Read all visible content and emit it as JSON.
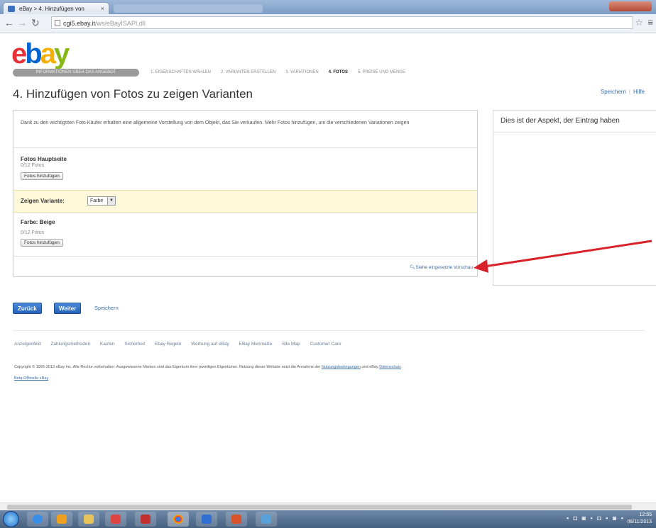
{
  "browser": {
    "tab_title": "eBay > 4. Hinzufügen von",
    "tab_close": "×",
    "address_host": "cgi5.ebay.it",
    "address_path": "/ws/eBayISAPI.dll",
    "icons": [
      "back-icon",
      "forward-icon",
      "reload-icon",
      "star-icon",
      "menu-icon"
    ]
  },
  "brand": {
    "e": "e",
    "b": "b",
    "a": "a",
    "y": "y"
  },
  "progress": {
    "done_label": "INFORMATIONEN ÜBER DAS ANGEBOT",
    "steps": [
      "1. EIGENSCHAFTEN WÄHLEN",
      "2. VARIANTEN ERSTELLEN",
      "3. VARIATIONEN",
      "4. FOTOS",
      "5. PREISE UND MENGE"
    ],
    "active_index": 3
  },
  "page": {
    "title": "4. Hinzufügen von Fotos zu zeigen Varianten",
    "link_save": "Speichern",
    "link_help": "Hilfe"
  },
  "main": {
    "info_text": "Dank zu den wichtigsten Foto Käufer erhalten eine allgemeine Vorstellung von dem Objekt, das Sie verkaufen. Mehr Fotos hinzufügen, um die verschiedenen Variationen zeigen",
    "main_photos_title": "Fotos Hauptseite",
    "main_photos_count": "0/12 Fotos",
    "add_photos_button": "Fotos hinzufügen",
    "variant_label": "Zeigen Variante:",
    "variant_value": "Farbe",
    "color_title": "Farbe: Beige",
    "color_count": "0/12 Fotos",
    "color_add_button": "Fotos hinzufügen",
    "preview_link": "Siehe eingesetzte Vorschau"
  },
  "preview": {
    "title": "Dies ist der Aspekt, der Eintrag haben"
  },
  "actions": {
    "back": "Zurück",
    "next": "Weiter",
    "save": "Speichern"
  },
  "footer": {
    "links": [
      "Anzeigenfeld",
      "Zahlungsmethoden",
      "Kaufen",
      "Sicherheit",
      "Ebay Regeln",
      "Werbung auf eBay",
      "EBay Menmaße",
      "Site Map",
      "Customer Care"
    ],
    "copyright": "Copyright © 1995-2013 eBay Inc. Alle Rechte vorbehalten. Ausgewiesene Marken sind das Eigentum ihrer jeweiligen Eigentümer. Nutzung dieser Website setzt die Annahme der",
    "copyright_link1": "Nutzungsbedingungen",
    "copyright_mid": "und eBay",
    "copyright_link2": "Datenschutz",
    "copyright_line2": "Beta-Offizielle eBay"
  },
  "taskbar": {
    "tray_text": "▪ ◘ ◙ ▪ ◘ ▪ ◙ ▪",
    "clock_time": "12:55",
    "clock_date": "06/11/2013"
  },
  "colors": {
    "accent_blue": "#2563b8",
    "annotation_red": "#d8232a",
    "highlight_row": "#fdf8d9"
  }
}
